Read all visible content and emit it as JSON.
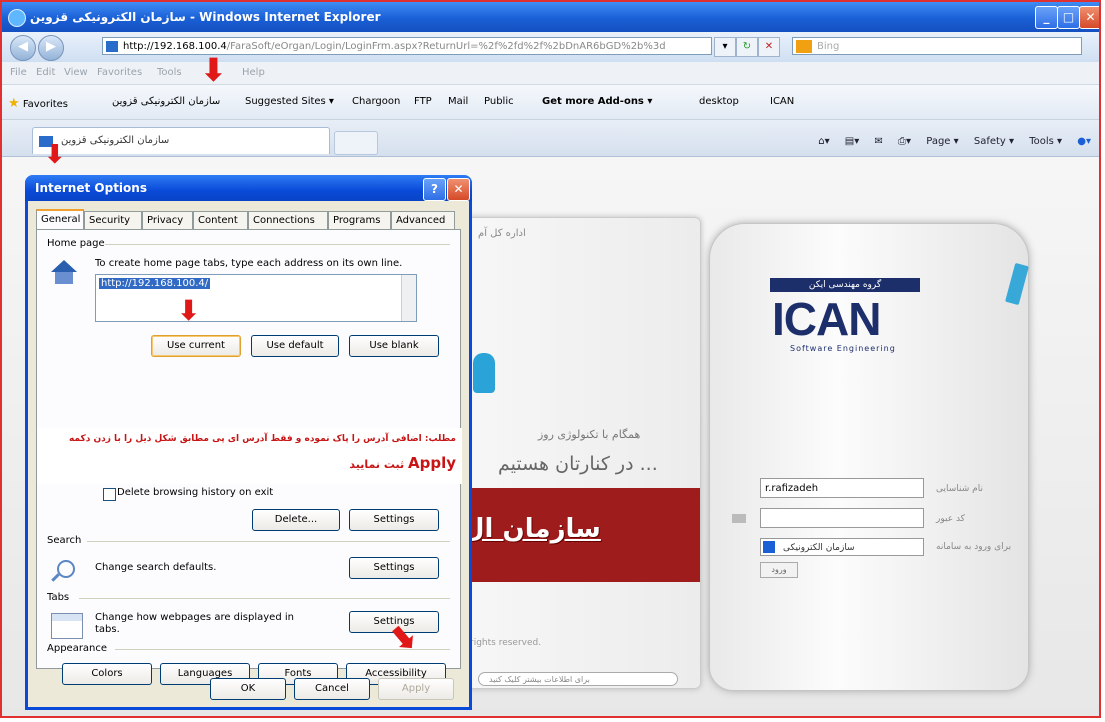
{
  "browser": {
    "title": "سازمان الکترونیکی قزوین - Windows Internet Explorer",
    "address": {
      "url_host": "http://192.168.100.4",
      "url_rest": "/FaraSoft/eOrgan/Login/LoginFrm.aspx?ReturnUrl=%2f%2fd%2f%2bDnAR6bGD%2b%3d"
    },
    "search_placeholder": "Bing",
    "menu": [
      "File",
      "Edit",
      "View",
      "Favorites",
      "Tools",
      "Help"
    ],
    "favorites": {
      "label": "Favorites",
      "items": [
        "سازمان الکترونیکی قزوین",
        "Suggested Sites ▾",
        "Chargoon",
        "FTP",
        "Mail",
        "Public",
        "Get more Add-ons ▾",
        "desktop",
        "ICAN"
      ]
    },
    "tab_title": "سازمان الکترونیکی قزوین",
    "commands": [
      "Page ▾",
      "Safety ▾",
      "Tools ▾"
    ]
  },
  "page": {
    "admin_text": "اداره کل آم",
    "tagline1": "همگام با تکنولوژی روز",
    "tagline2": "در کنارتان هستیم ...",
    "banner_text": "سازمان ال",
    "rights": "rights reserved.",
    "bottom_bar": "برای اطلاعات بیشتر کلیک کنید",
    "logo_top": "گروه مهندسی ایکن",
    "logo_word": "ICAN",
    "logo_sub": "Software Engineering",
    "login": {
      "username_label": "نام شناسایی",
      "username_value": "r.rafizadeh",
      "password_label": "کد عبور",
      "password_value": "",
      "org_label": "برای ورود به سامانه",
      "org_value": "سازمان الکترونیکی",
      "submit": "ورود"
    }
  },
  "dialog": {
    "title": "Internet Options",
    "tabs": [
      "General",
      "Security",
      "Privacy",
      "Content",
      "Connections",
      "Programs",
      "Advanced"
    ],
    "home_page": {
      "group": "Home page",
      "description": "To create home page tabs, type each address on its own line.",
      "url": "http://192.168.100.4/",
      "use_current": "Use current",
      "use_default": "Use default",
      "use_blank": "Use blank"
    },
    "note": {
      "line1": "مطلب: اضافی آدرس را پاک نموده و فقط آدرس ای پی مطابق شکل ذیل را با زدن دکمه",
      "apply_word": "Apply",
      "line2_suffix": "ثبت نمایید"
    },
    "history": {
      "delete_on_exit": "Delete browsing history on exit",
      "delete": "Delete...",
      "settings": "Settings"
    },
    "search": {
      "group": "Search",
      "description": "Change search defaults.",
      "settings": "Settings"
    },
    "tabs_group": {
      "group": "Tabs",
      "description": "Change how webpages are displayed in tabs.",
      "settings": "Settings"
    },
    "appearance": {
      "group": "Appearance",
      "colors": "Colors",
      "languages": "Languages",
      "fonts": "Fonts",
      "accessibility": "Accessibility"
    },
    "ok": "OK",
    "cancel": "Cancel",
    "apply": "Apply"
  },
  "colors": {
    "annotation_red": "#e01818",
    "xp_blue": "#0a4ad8",
    "banner_red": "#9e1c1c",
    "ican_navy": "#1d2f6b"
  }
}
